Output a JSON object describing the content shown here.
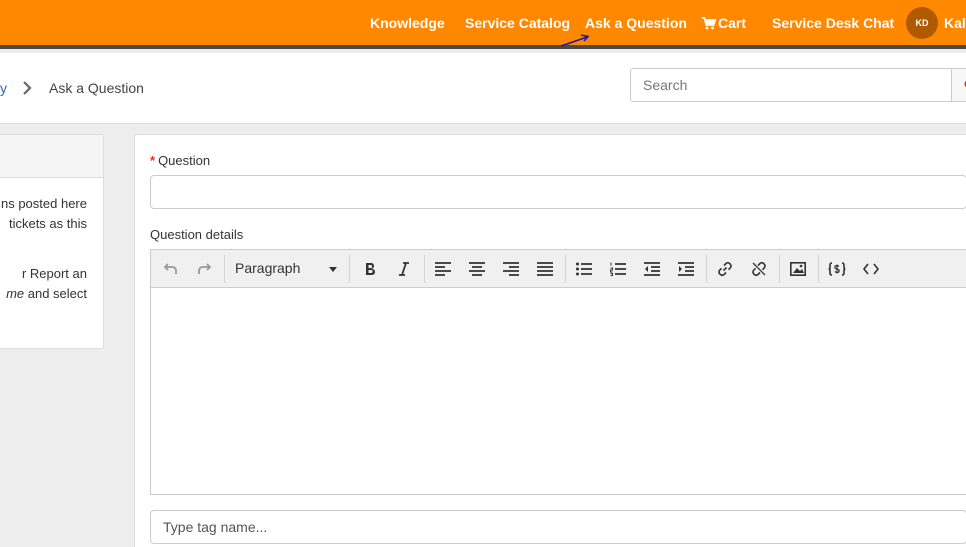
{
  "nav": {
    "knowledge": "Knowledge",
    "service_catalog": "Service Catalog",
    "ask_question": "Ask a Question",
    "cart": "Cart",
    "service_desk_chat": "Service Desk Chat",
    "avatar_initials": "KD",
    "user_name": "Kali"
  },
  "breadcrumb": {
    "previous": "y",
    "current": "Ask a Question"
  },
  "search": {
    "placeholder": "Search"
  },
  "left_panel": {
    "lines": [
      "ns posted here",
      "tickets as this",
      "r Report an",
      "me and select"
    ]
  },
  "form": {
    "question_required": "*",
    "question_label": "Question",
    "details_label": "Question details",
    "paragraph_select": "Paragraph",
    "tag_placeholder": "Type tag name..."
  },
  "toolbar_icons": [
    "undo-icon",
    "redo-icon",
    "bold-icon",
    "italic-icon",
    "align-left-icon",
    "align-center-icon",
    "align-right-icon",
    "align-justify-icon",
    "bullet-list-icon",
    "numbered-list-icon",
    "outdent-icon",
    "indent-icon",
    "link-icon",
    "unlink-icon",
    "image-icon",
    "code-sample-icon",
    "source-code-icon"
  ],
  "colors": {
    "header": "#ff8800",
    "header_border": "#4a4a4a",
    "required": "#d9352b"
  }
}
